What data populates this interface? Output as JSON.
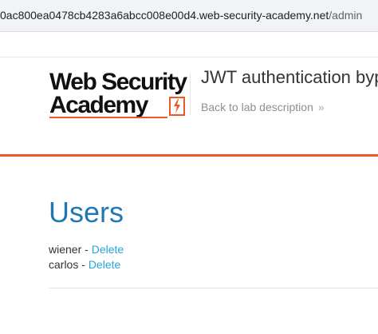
{
  "browser": {
    "url_host": "0ac800ea0478cb4283a6abcc008e00d4.web-security-academy.net",
    "url_path": "/admin"
  },
  "header": {
    "logo_line1": "Web Security",
    "logo_line2": "Academy",
    "lab_title": "JWT authentication bypa",
    "back_link": "Back to lab description",
    "back_link_icon": "double-chevron-right-icon",
    "accent_color": "#f0562b"
  },
  "main": {
    "heading": "Users",
    "heading_color": "#1f78b4",
    "users": [
      {
        "name": "wiener",
        "separator": " - ",
        "action": "Delete"
      },
      {
        "name": "carlos",
        "separator": " - ",
        "action": "Delete"
      }
    ],
    "link_color": "#29a3d6"
  }
}
